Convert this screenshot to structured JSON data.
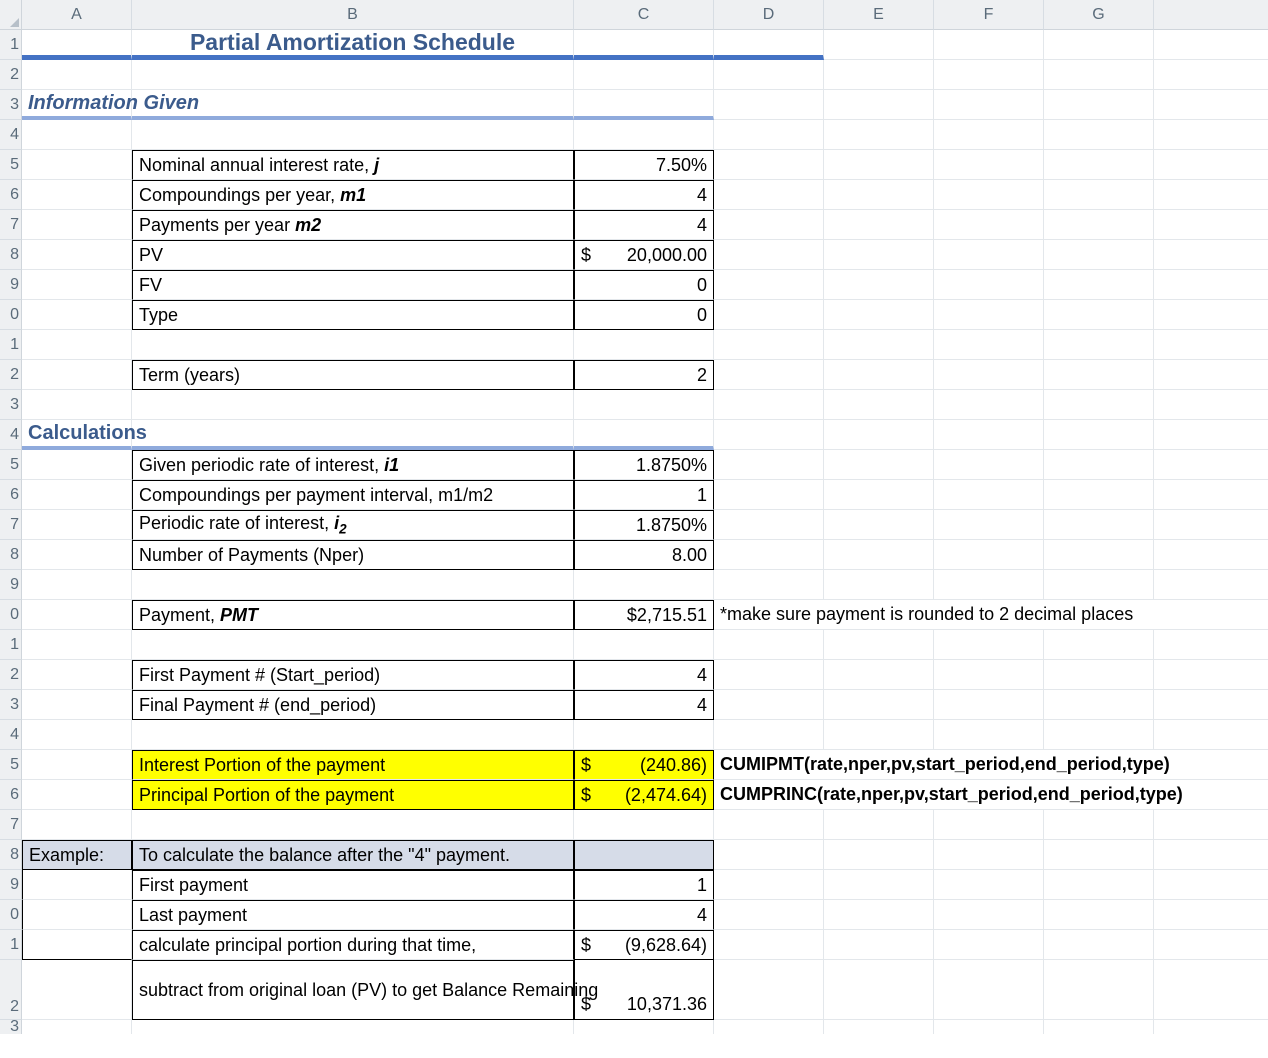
{
  "columns": [
    "A",
    "B",
    "C",
    "D",
    "E",
    "F",
    "G"
  ],
  "row_numbers": [
    "1",
    "2",
    "3",
    "4",
    "5",
    "6",
    "7",
    "8",
    "9",
    "0",
    "1",
    "2",
    "3",
    "4",
    "5",
    "6",
    "7",
    "8",
    "9",
    "0",
    "1",
    "2",
    "3",
    "4",
    "5",
    "6",
    "7",
    "8",
    "9",
    "0",
    "1",
    "2",
    "3"
  ],
  "title": "Partial Amortization Schedule",
  "section1": "Information Given",
  "section2": "Calculations",
  "info": {
    "rate_label_prefix": "Nominal annual interest rate, ",
    "rate_var": "j",
    "rate_val": "7.50%",
    "comp_label_prefix": "Compoundings per year, ",
    "comp_var": "m1",
    "comp_val": "4",
    "pay_label_prefix": "Payments per year ",
    "pay_var": "m2",
    "pay_val": "4",
    "pv_label": "PV",
    "pv_sym": "$",
    "pv_val": "20,000.00",
    "fv_label": "FV",
    "fv_val": "0",
    "type_label": "Type",
    "type_val": "0",
    "term_label": "Term (years)",
    "term_val": "2"
  },
  "calc": {
    "given_rate_prefix": "Given periodic rate of interest, ",
    "given_rate_var": "i1",
    "given_rate_val": "1.8750%",
    "comp_per_pay_label": "Compoundings per payment interval, m1/m2",
    "comp_per_pay_val": "1",
    "periodic_rate_prefix": "Periodic rate of interest, ",
    "periodic_rate_var_i": "i",
    "periodic_rate_var_sub": "2",
    "periodic_rate_val": "1.8750%",
    "nper_label": "Number of Payments (Nper)",
    "nper_val": "8.00",
    "pmt_prefix": "Payment, ",
    "pmt_var": "PMT",
    "pmt_val": "$2,715.51",
    "pmt_note": "*make sure payment is rounded to 2 decimal places",
    "first_label": "First Payment # (Start_period)",
    "first_val": "4",
    "final_label": "Final Payment # (end_period)",
    "final_val": "4",
    "interest_label": "Interest Portion of the payment",
    "interest_sym": "$",
    "interest_val": "(240.86)",
    "interest_formula": "CUMIPMT(rate,nper,pv,start_period,end_period,type)",
    "principal_label": "Principal Portion of the payment",
    "principal_sym": "$",
    "principal_val": "(2,474.64)",
    "principal_formula": "CUMPRINC(rate,nper,pv,start_period,end_period,type)"
  },
  "example": {
    "heading_a": "Example:",
    "heading_b": "To calculate the balance after the \"4\" payment.",
    "row1_label": "First payment",
    "row1_val": "1",
    "row2_label": "Last payment",
    "row2_val": "4",
    "row3_label": "calculate principal portion during that time,",
    "row3_sym": "$",
    "row3_val": "(9,628.64)",
    "row4_label": "subtract from original loan (PV) to get Balance Remaining",
    "row4_sym": "$",
    "row4_val": "10,371.36"
  }
}
